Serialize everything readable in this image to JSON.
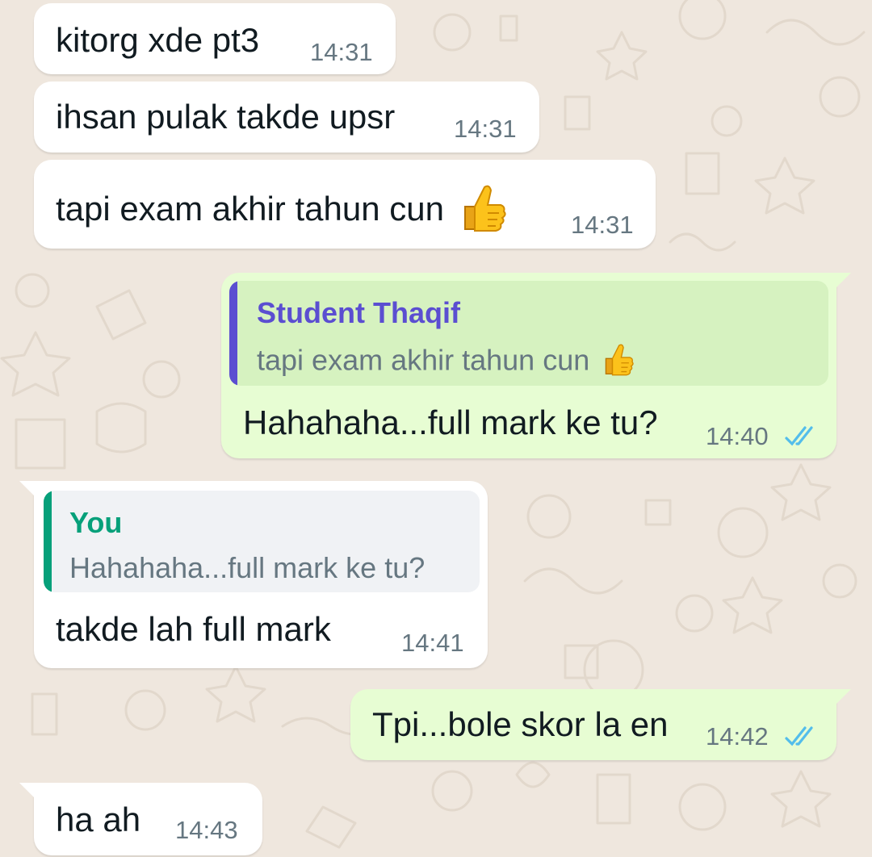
{
  "colors": {
    "wallpaper": "#efe7de",
    "incoming_bubble": "#ffffff",
    "outgoing_bubble": "#e7fdd3",
    "quote_author_other": "#5b4ed1",
    "quote_author_self": "#06a07a",
    "read_ticks": "#53bdeb",
    "timestamp": "#667781"
  },
  "messages": [
    {
      "direction": "incoming",
      "text": "kitorg xde pt3",
      "time": "14:31"
    },
    {
      "direction": "incoming",
      "text": "ihsan pulak takde upsr",
      "time": "14:31"
    },
    {
      "direction": "incoming",
      "text": "tapi exam akhir tahun cun",
      "emoji": "thumbs-up",
      "time": "14:31"
    },
    {
      "direction": "outgoing",
      "quote": {
        "author": "Student Thaqif",
        "text": "tapi exam akhir tahun cun",
        "emoji": "thumbs-up"
      },
      "text": "Hahahaha...full mark ke tu?",
      "time": "14:40",
      "status": "read-double-tick"
    },
    {
      "direction": "incoming",
      "quote": {
        "author": "You",
        "text": "Hahahaha...full mark ke tu?"
      },
      "text": "takde lah full mark",
      "time": "14:41"
    },
    {
      "direction": "outgoing",
      "text": "Tpi...bole skor la en",
      "time": "14:42",
      "status": "read-double-tick"
    },
    {
      "direction": "incoming",
      "text": "ha ah",
      "time": "14:43"
    }
  ]
}
